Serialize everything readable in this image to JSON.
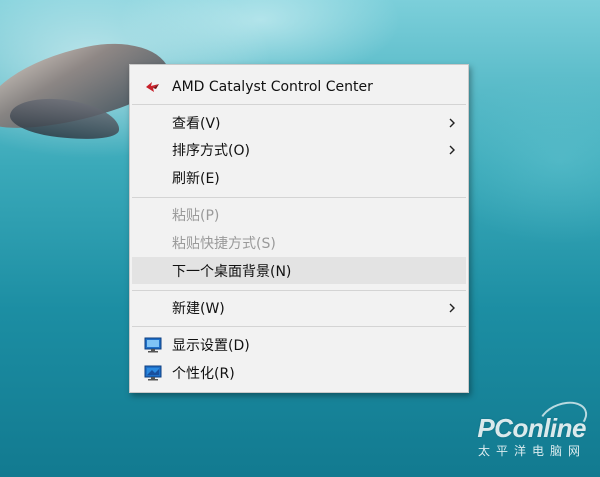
{
  "desktop": {
    "watermark_brand": "PConline",
    "watermark_sub": "太平洋电脑网"
  },
  "context_menu": {
    "items": [
      {
        "label": "AMD Catalyst Control Center",
        "icon": "amd-catalyst-icon"
      },
      {
        "label": "查看(V)",
        "submenu": true
      },
      {
        "label": "排序方式(O)",
        "submenu": true
      },
      {
        "label": "刷新(E)"
      },
      {
        "label": "粘贴(P)",
        "disabled": true
      },
      {
        "label": "粘贴快捷方式(S)",
        "disabled": true
      },
      {
        "label": "下一个桌面背景(N)",
        "highlighted": true
      },
      {
        "label": "新建(W)",
        "submenu": true
      },
      {
        "label": "显示设置(D)",
        "icon": "display-settings-icon"
      },
      {
        "label": "个性化(R)",
        "icon": "personalize-icon"
      }
    ]
  },
  "colors": {
    "menu_background": "#f2f2f2",
    "highlight": "#e3e3e3",
    "disabled_text": "#9a9a9a",
    "water": "#1c8ea3"
  }
}
